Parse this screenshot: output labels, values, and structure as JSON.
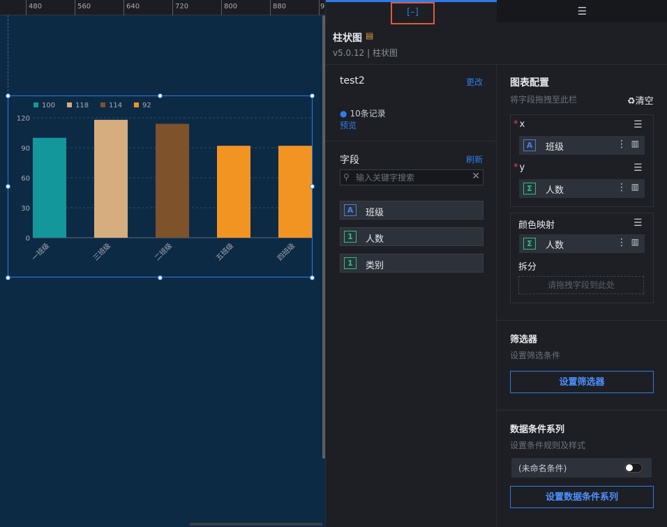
{
  "ruler": {
    "ticks": [
      "480",
      "560",
      "640",
      "720",
      "800",
      "880",
      "9"
    ]
  },
  "chart_data": {
    "type": "bar",
    "categories": [
      "一班级",
      "三班级",
      "二班级",
      "五班级",
      "四班级"
    ],
    "values": [
      100,
      118,
      114,
      92,
      92
    ],
    "colors": [
      "#14979a",
      "#d5ad7e",
      "#7e522b",
      "#f29422",
      "#f29422"
    ],
    "legend": [
      {
        "label": "100",
        "color": "#14979a"
      },
      {
        "label": "118",
        "color": "#d5ad7e"
      },
      {
        "label": "114",
        "color": "#7e522b"
      },
      {
        "label": "92",
        "color": "#f29422"
      }
    ],
    "legend_position": "top-left",
    "ylim": [
      0,
      120
    ],
    "yticks": [
      "0",
      "30",
      "60",
      "90",
      "120"
    ],
    "grid": true
  },
  "tabs": {
    "data_icon": "[–]",
    "style_icon": "sliders-icon"
  },
  "component": {
    "title": "柱状图",
    "version": "v5.0.12 | 柱状图"
  },
  "datasource": {
    "name": "test2",
    "change": "更改",
    "records": "10条记录",
    "preview": "预览"
  },
  "fields": {
    "title": "字段",
    "refresh": "刷新",
    "search_placeholder": "输入关键字搜索",
    "items": [
      {
        "badge": "A",
        "label": "班级"
      },
      {
        "badge": "1",
        "label": "人数"
      },
      {
        "badge": "1",
        "label": "类别"
      }
    ]
  },
  "config": {
    "title": "图表配置",
    "hint": "将字段拖拽至此栏",
    "clear": "清空",
    "x": {
      "label": "x",
      "badge": "A",
      "field": "班级"
    },
    "y": {
      "label": "y",
      "badge": "Σ",
      "field": "人数"
    },
    "color": {
      "label": "颜色映射",
      "badge": "Σ",
      "field": "人数"
    },
    "split": {
      "label": "拆分",
      "drop": "请拖拽字段到此处"
    }
  },
  "filter": {
    "title": "筛选器",
    "hint": "设置筛选条件",
    "button": "设置筛选器"
  },
  "conditions": {
    "title": "数据条件系列",
    "hint": "设置条件规则及样式",
    "item": "(未命名条件)",
    "button": "设置数据条件系列"
  }
}
